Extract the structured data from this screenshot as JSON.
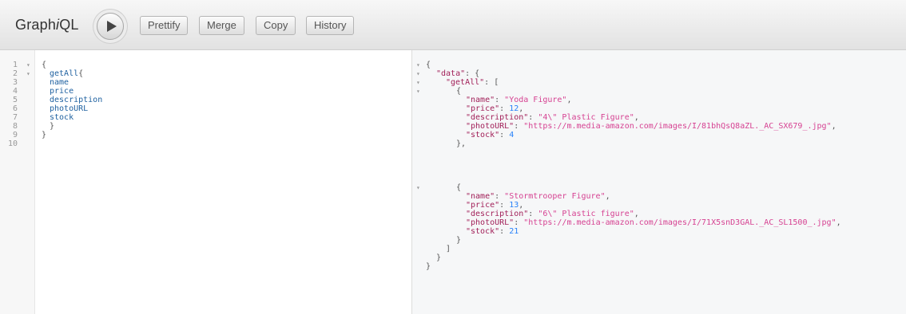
{
  "app": {
    "title_prefix": "Graph",
    "title_italic": "i",
    "title_suffix": "QL"
  },
  "toolbar": {
    "prettify_label": "Prettify",
    "merge_label": "Merge",
    "copy_label": "Copy",
    "history_label": "History"
  },
  "query_editor": {
    "line_numbers": [
      "1",
      "2",
      "3",
      "4",
      "5",
      "6",
      "7",
      "8",
      "9",
      "10"
    ],
    "lines": {
      "l1": "{",
      "l2_field": "getAll",
      "l2_brace": "{",
      "l3": "name",
      "l4": "price",
      "l5": "description",
      "l6": "photoURL",
      "l7": "stock",
      "l8": "}",
      "l9": "}"
    }
  },
  "result": {
    "open": "{",
    "data_key": "\"data\"",
    "get_all_key": "\"getAll\"",
    "colon": ": ",
    "obj_open": "{",
    "arr_open": "[",
    "arr_close": "]",
    "close": "}",
    "items": [
      {
        "name_key": "\"name\"",
        "name_val": "\"Yoda Figure\"",
        "price_key": "\"price\"",
        "price_val": "12",
        "desc_key": "\"description\"",
        "desc_val": "\"4\\\" Plastic Figure\"",
        "photo_key": "\"photoURL\"",
        "photo_val": "\"https://m.media-amazon.com/images/I/81bhQsQ8aZL._AC_SX679_.jpg\"",
        "stock_key": "\"stock\"",
        "stock_val": "4"
      },
      {
        "name_key": "\"name\"",
        "name_val": "\"Stormtrooper Figure\"",
        "price_key": "\"price\"",
        "price_val": "13",
        "desc_key": "\"description\"",
        "desc_val": "\"6\\\" Plastic figure\"",
        "photo_key": "\"photoURL\"",
        "photo_val": "\"https://m.media-amazon.com/images/I/71X5snD3GAL._AC_SL1500_.jpg\"",
        "stock_key": "\"stock\"",
        "stock_val": "21"
      }
    ]
  }
}
